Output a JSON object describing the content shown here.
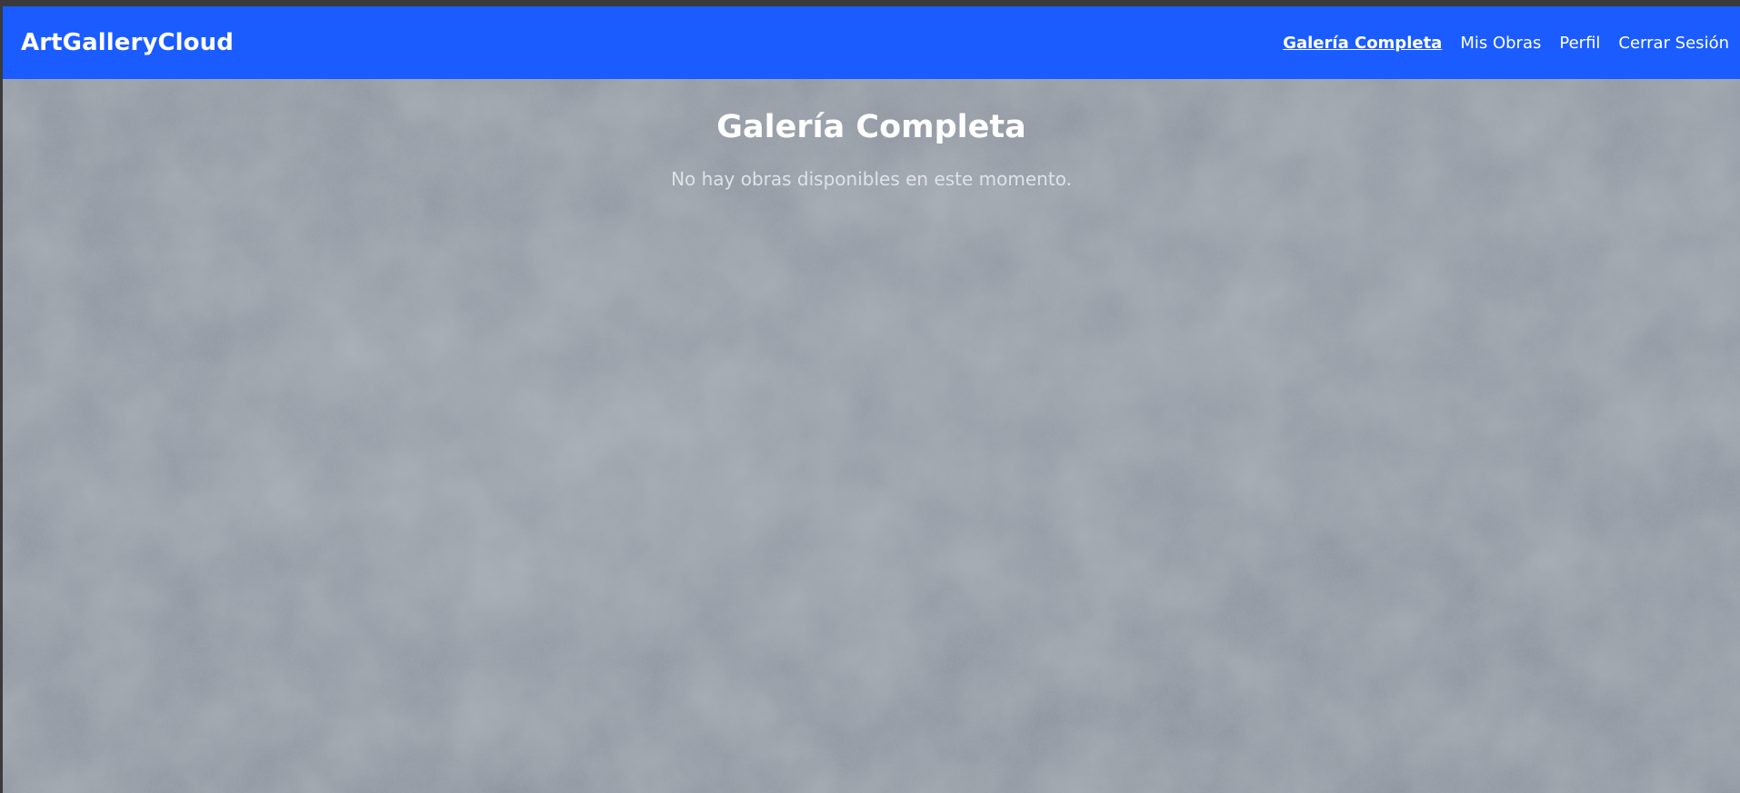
{
  "brand": "ArtGalleryCloud",
  "nav": {
    "items": [
      {
        "label": "Galería Completa",
        "active": true
      },
      {
        "label": "Mis Obras",
        "active": false
      },
      {
        "label": "Perfil",
        "active": false
      },
      {
        "label": "Cerrar Sesión",
        "active": false
      }
    ]
  },
  "main": {
    "title": "Galería Completa",
    "empty_message": "No hay obras disponibles en este momento."
  },
  "colors": {
    "navbar": "#1a5cff",
    "background": "#8e959f",
    "text": "#ffffff"
  }
}
